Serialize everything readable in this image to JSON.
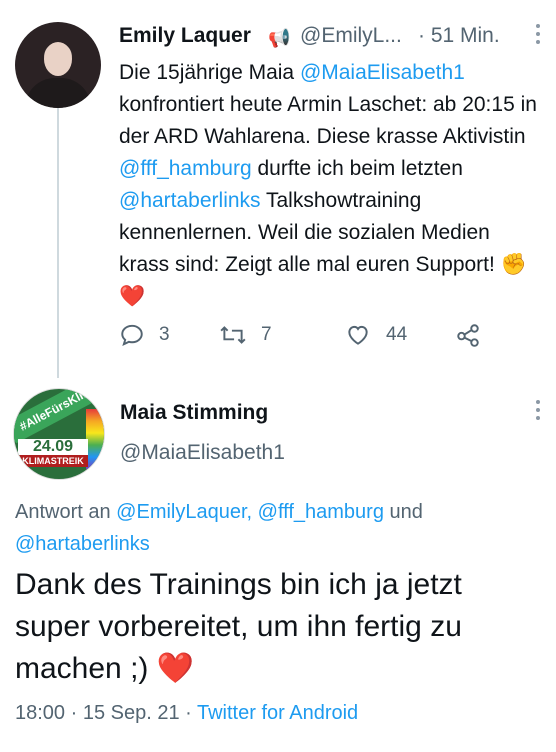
{
  "tweet1": {
    "author_name": "Emily Laquer",
    "handle": "@EmilyL...",
    "time": "· 51 Min.",
    "text_parts": [
      {
        "t": "Die 15jährige Maia ",
        "m": false
      },
      {
        "t": "@MaiaElisabeth1",
        "m": true
      },
      {
        "t": " konfrontiert heute Armin Laschet: ab 20:15 in der ARD Wahlarena. Diese krasse Aktivistin ",
        "m": false
      },
      {
        "t": "@fff_hamburg",
        "m": true
      },
      {
        "t": " durfte ich beim letzten ",
        "m": false
      },
      {
        "t": "@hartaberlinks",
        "m": true
      },
      {
        "t": " Talkshowtraining kennenlernen. Weil die sozialen Medien krass sind: Zeigt alle mal euren Support! ",
        "m": false
      }
    ],
    "emoji": "✊❤️",
    "actions": {
      "reply_count": "3",
      "retweet_count": "7",
      "like_count": "44"
    }
  },
  "tweet2": {
    "author_name": "Maia Stimming",
    "handle": "@MaiaElisabeth1",
    "avatar": {
      "banner": "#AlleFürsKlima",
      "date": "24.09",
      "tag": "KLIMASTREIK"
    },
    "reply_prefix": "Antwort an ",
    "reply_mentions": "@EmilyLaquer, @fff_hamburg",
    "reply_and": " und ",
    "reply_mention_last": "@hartaberlinks",
    "text": "Dank des Trainings bin ich ja jetzt super vorbereitet, um ihn fertig zu machen ;) ",
    "heart": "❤️",
    "timestamp": "18:00 · 15 Sep. 21 · ",
    "source": "Twitter for Android"
  },
  "colors": {
    "accent": "#1d9bf0",
    "muted": "#536471",
    "text": "#0f1419"
  }
}
